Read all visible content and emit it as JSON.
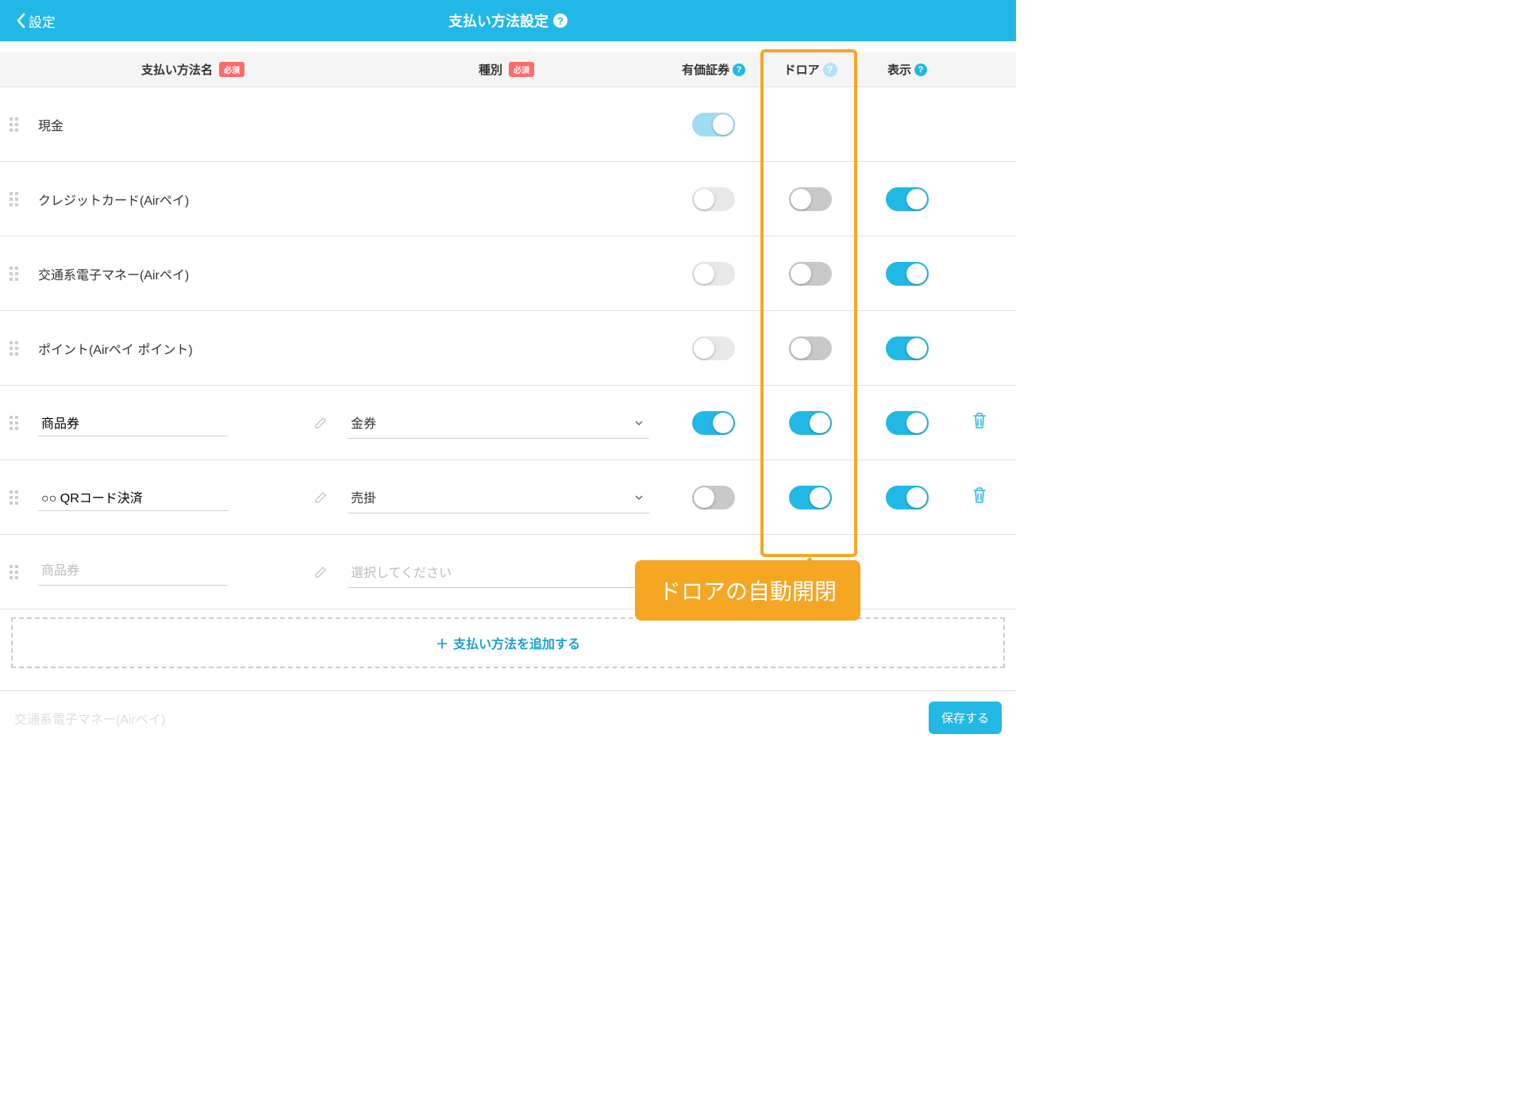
{
  "header": {
    "back": "設定",
    "title": "支払い方法設定"
  },
  "columns": {
    "name": "支払い方法名",
    "type": "種別",
    "securities": "有価証券",
    "drawer": "ドロア",
    "display": "表示",
    "required": "必須"
  },
  "rows": [
    {
      "name": "現金"
    },
    {
      "name": "クレジットカード(Airペイ)"
    },
    {
      "name": "交通系電子マネー(Airペイ)"
    },
    {
      "name": "ポイント(Airペイ ポイント)"
    },
    {
      "name": "商品券",
      "type": "金券"
    },
    {
      "name": "○○ QRコード決済",
      "type": "売掛"
    }
  ],
  "newRow": {
    "namePlaceholder": "商品券",
    "typePlaceholder": "選択してください"
  },
  "addButton": "支払い方法を追加する",
  "footer": {
    "ghost": "交通系電子マネー(Airペイ)",
    "save": "保存する"
  },
  "callout": "ドロアの自動開閉"
}
